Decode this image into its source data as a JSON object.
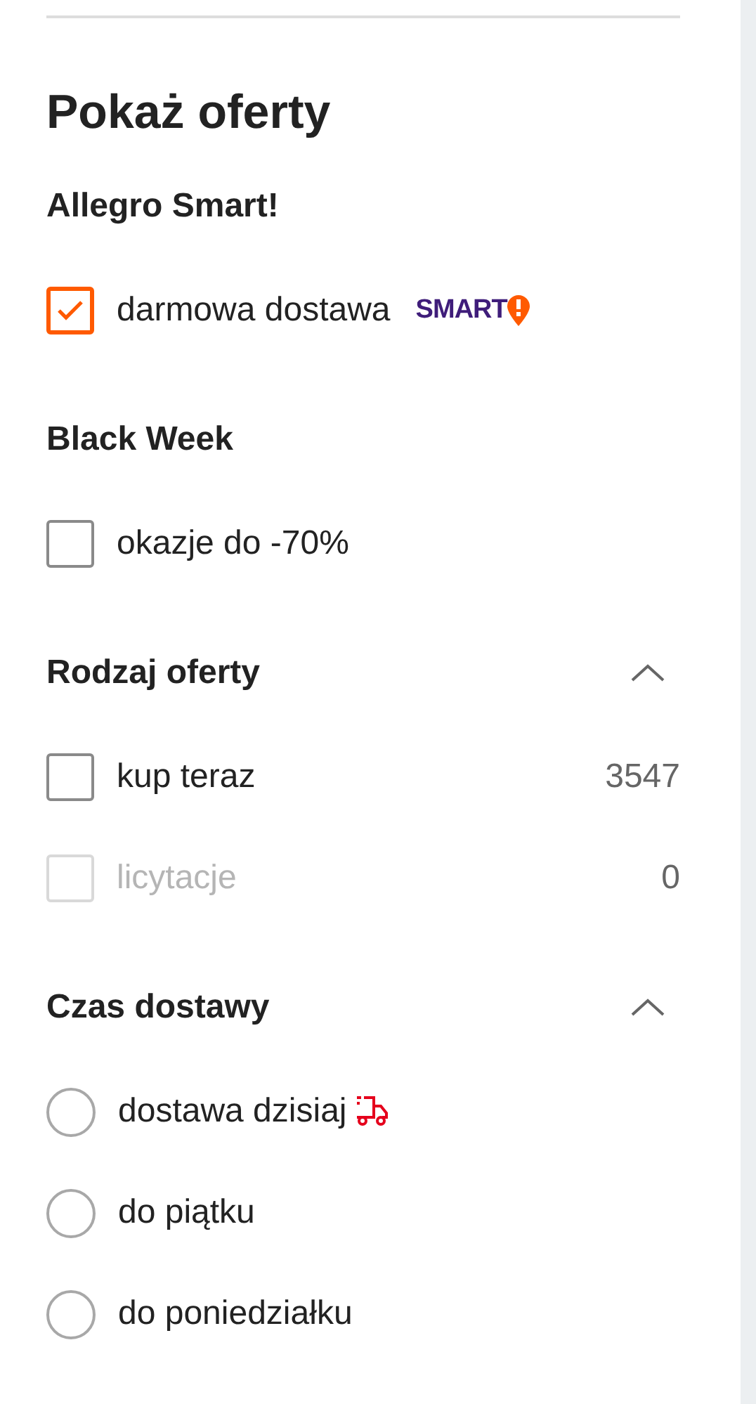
{
  "title": "Pokaż oferty",
  "sections": [
    {
      "heading": "Allegro Smart!",
      "kind": "checkbox",
      "items": [
        {
          "label": "darmowa dostawa",
          "checked": true,
          "disabled": false,
          "badge": "SMART"
        }
      ]
    },
    {
      "heading": "Black Week",
      "kind": "checkbox",
      "items": [
        {
          "label": "okazje do -70%",
          "checked": false,
          "disabled": false
        }
      ]
    },
    {
      "heading": "Rodzaj oferty",
      "kind": "checkbox",
      "expanded": true,
      "items": [
        {
          "label": "kup teraz",
          "checked": false,
          "disabled": false,
          "count": "3547"
        },
        {
          "label": "licytacje",
          "checked": false,
          "disabled": true,
          "count": "0"
        }
      ]
    },
    {
      "heading": "Czas dostawy",
      "kind": "radio",
      "expanded": true,
      "items": [
        {
          "label": "dostawa dzisiaj",
          "selected": false,
          "truck": true
        },
        {
          "label": "do piątku",
          "selected": false
        },
        {
          "label": "do poniedziałku",
          "selected": false
        }
      ]
    }
  ]
}
